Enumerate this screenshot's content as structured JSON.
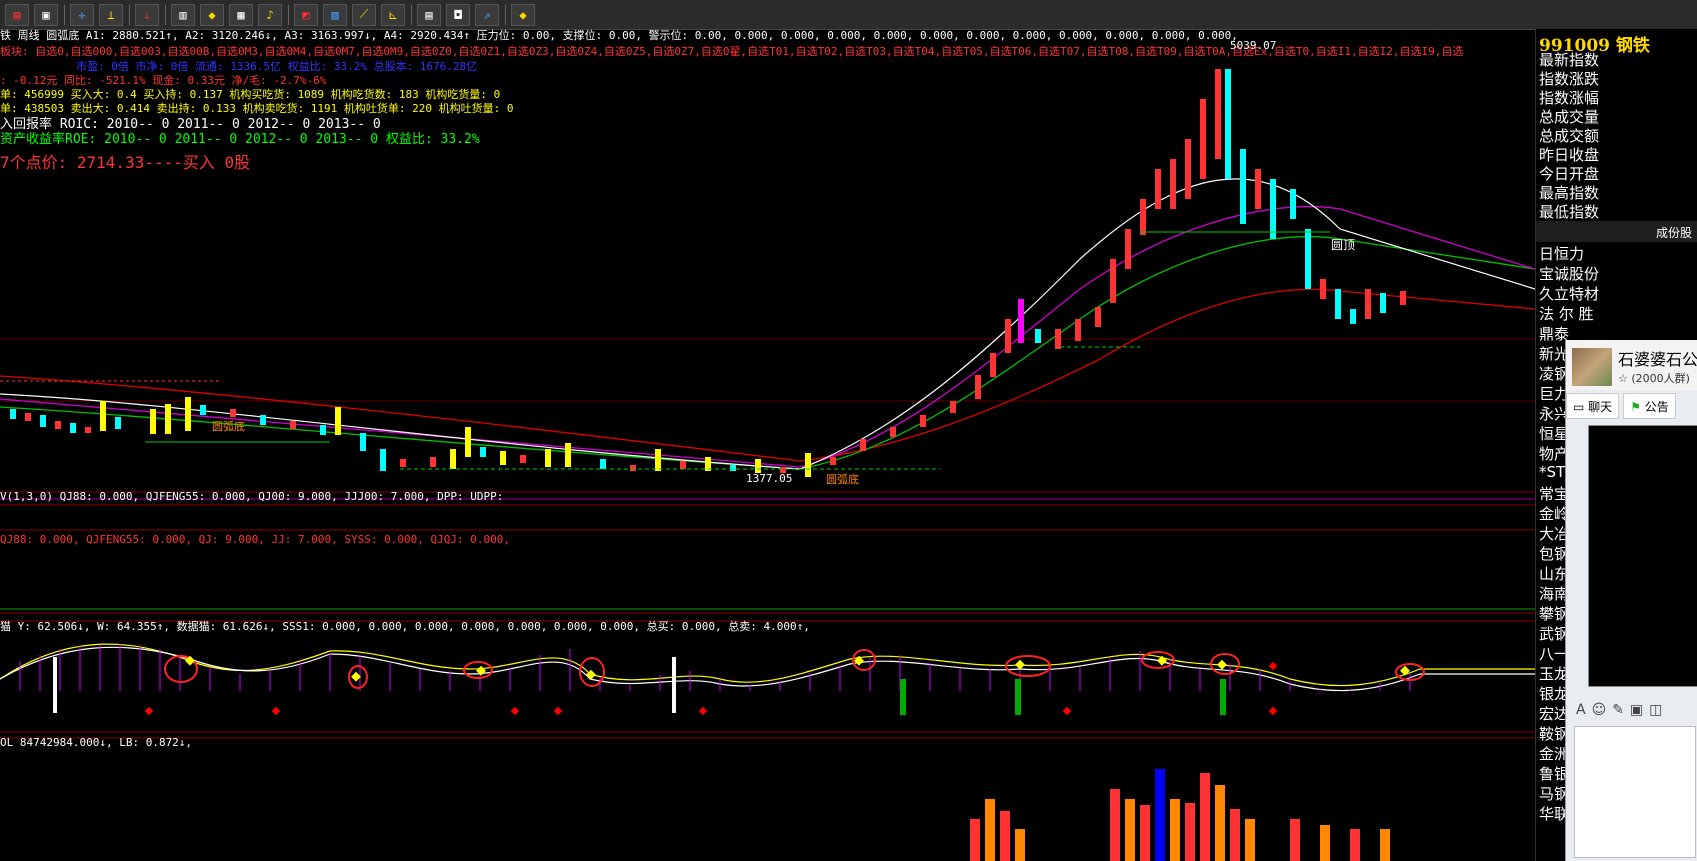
{
  "toolbar": {
    "icons": [
      "menu-icon",
      "dashboard-icon",
      "crosshair-icon",
      "ruler-icon",
      "arrow-icon",
      "candle-icon",
      "diamond-icon",
      "grid-icon",
      "bell-icon",
      "picture-icon",
      "chart-icon",
      "trend-icon",
      "cursor-icon",
      "table-icon",
      "page-icon",
      "share-icon",
      "diamond-icon"
    ]
  },
  "chart": {
    "header_line": "铁 周线 圆弧底 A1: 2880.521↑, A2: 3120.246↓, A3: 3163.997↓, A4: 2920.434↑ 压力位: 0.00, 支撑位: 0.00, 警示位: 0.00, 0.000, 0.000, 0.000, 0.000, 0.000, 0.000, 0.000, 0.000, 0.000, 0.000, 0.000,",
    "xuan_line": "板块: 自选0,自选000,自选003,自选00B,自选0M3,自选0M4,自选0M7,自选0M9,自选0Z0,自选0Z1,自选0Z3,自选0Z4,自选0Z5,自选0Z7,自选0翟,自选T01,自选T02,自选T03,自选T04,自选T05,自选T06,自选T07,自选T08,自选T09,自选T0A,自选Ex,自选T0,自选I1,自选I2,自选I9,自选",
    "info1": "市盈: 0倍      市净: 0倍      流通: 1336.5亿      权益比: 33.2%      总股本: 1676.28亿",
    "info2": ": -0.12元      同比: -521.1%      现金: 0.33元      净/毛: -2.7%-6%",
    "info3": "单: 456999       买入大: 0.4        买入持: 0.137      机构买吃货: 1089   机构吃货数: 183    机构吃货量: 0",
    "info4": "单: 438503       卖出大: 0.414      卖出持: 0.133      机构卖吃货: 1191   机构吐货单: 220    机构吐货量: 0",
    "roic": "入回报率 ROIC: 2010-- 0    2011-- 0    2012-- 0    2013-- 0",
    "roe": "资产收益率ROE: 2010-- 0    2011-- 0    2012-- 0    2013-- 0     权益比: 33.2%",
    "buy_point": "7个点价: 2714.33----买入 0股",
    "high_label": "5039.07",
    "low_label": "1377.05",
    "pattern_top": "圆顶",
    "pattern_bottom": "圆弧底",
    "pattern_left": "圆弧底"
  },
  "panels": {
    "p1": "V(1,3,0) QJ88: 0.000, QJFENG55: 0.000, QJ00: 9.000, JJJ00: 7.000, DPP: UDPP:",
    "p2": "QJ88: 0.000, QJFENG55: 0.000, QJ: 9.000, JJ: 7.000, SYSS: 0.000, QJQJ: 0.000,",
    "p3": "猫 Y: 62.506↓, W: 64.355↑, 数据猫: 61.626↓, SSS1: 0.000, 0.000, 0.000, 0.000, 0.000, 0.000, 0.000, 总买: 0.000, 总卖: 4.000↑,",
    "p4": "OL 84742984.000↓, LB: 0.872↓,"
  },
  "right_panel": {
    "title": "991009 钢铁",
    "fields": [
      "最新指数",
      "指数涨跌",
      "指数涨幅",
      "总成交量",
      "总成交额",
      "昨日收盘",
      "今日开盘",
      "最高指数",
      "最低指数"
    ],
    "bar_label": "成份股",
    "stocks": [
      "日恒力",
      "宝诚股份",
      "久立特材",
      "法 尔 胜",
      "鼎泰",
      "新光",
      "凌钢",
      "巨力",
      "永兴",
      "恒星",
      "物产",
      "*ST",
      "常宝",
      "金岭",
      "大冶",
      "包钢",
      "山东",
      "海南",
      "攀钢",
      "武钢",
      "八一",
      "玉龙",
      "银龙",
      "宏达",
      "鞍钢",
      "金洲",
      "鲁银",
      "马钢",
      "华联矿业"
    ]
  },
  "chat_popup": {
    "name": "石婆婆石公",
    "sub": "(2000人群)",
    "tab_chat": "聊天",
    "tab_notice": "公告"
  }
}
